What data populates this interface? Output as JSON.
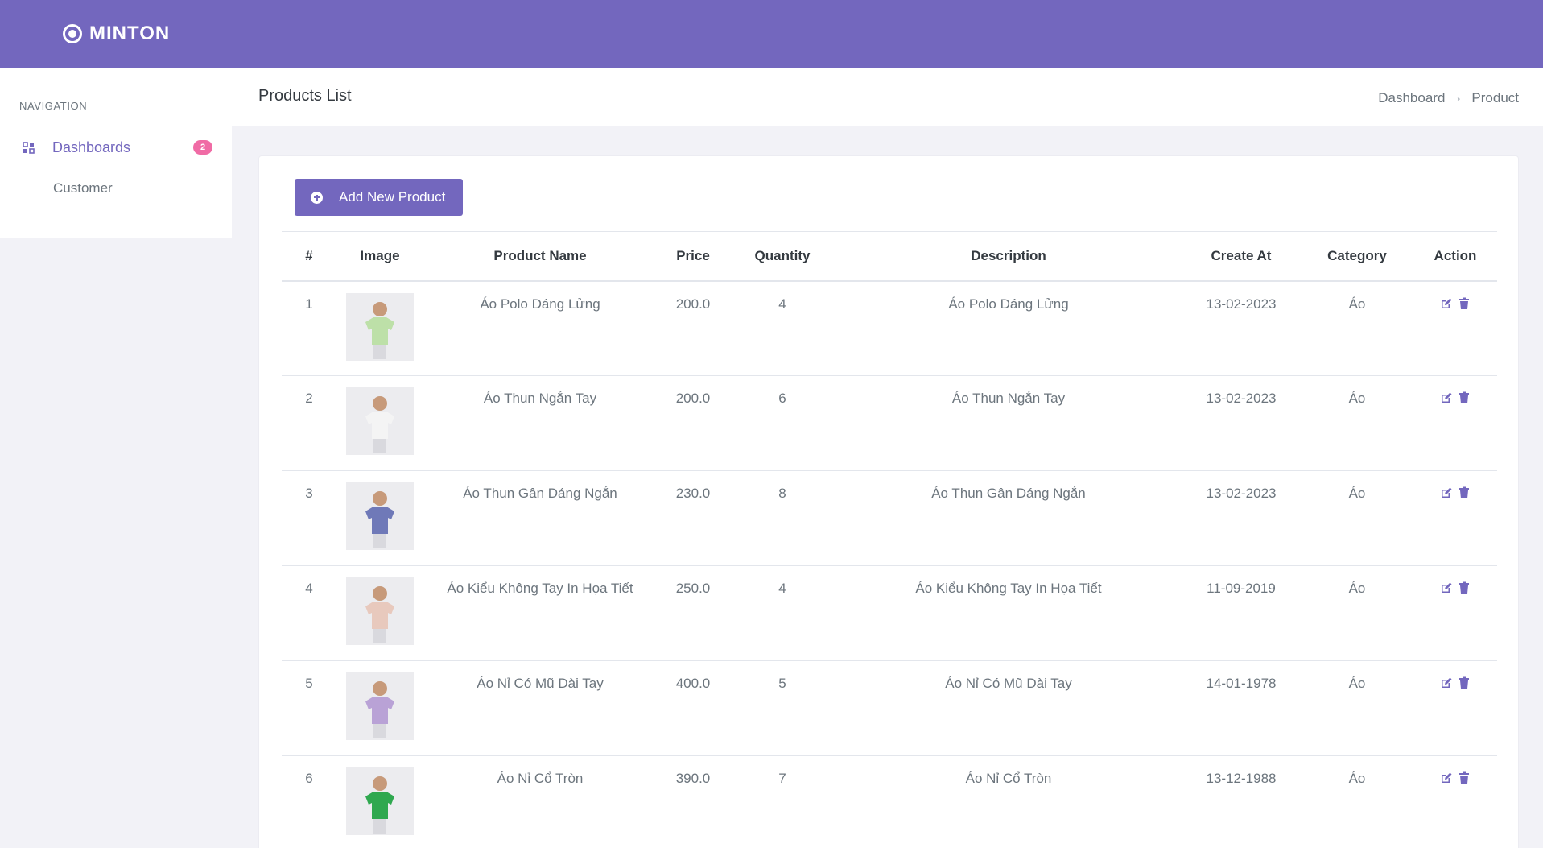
{
  "app": {
    "brand": "MINTON"
  },
  "sidebar": {
    "section_title": "NAVIGATION",
    "items": [
      {
        "label": "Dashboards",
        "badge": "2",
        "icon": "grid-icon"
      }
    ],
    "subitems": [
      {
        "label": "Customer"
      }
    ]
  },
  "header": {
    "title": "Products List",
    "breadcrumb": [
      "Dashboard",
      "Product"
    ]
  },
  "toolbar": {
    "add_label": "Add New Product"
  },
  "table": {
    "columns": [
      "#",
      "Image",
      "Product Name",
      "Price",
      "Quantity",
      "Description",
      "Create At",
      "Category",
      "Action"
    ],
    "rows": [
      {
        "id": "1",
        "name": "Áo Polo Dáng Lửng",
        "price": "200.0",
        "quantity": "4",
        "description": "Áo Polo Dáng Lửng",
        "created": "13-02-2023",
        "category": "Áo",
        "color": "#bde0a8"
      },
      {
        "id": "2",
        "name": "Áo Thun Ngắn Tay",
        "price": "200.0",
        "quantity": "6",
        "description": "Áo Thun Ngắn Tay",
        "created": "13-02-2023",
        "category": "Áo",
        "color": "#f4f4f4"
      },
      {
        "id": "3",
        "name": "Áo Thun Gân Dáng Ngắn",
        "price": "230.0",
        "quantity": "8",
        "description": "Áo Thun Gân Dáng Ngắn",
        "created": "13-02-2023",
        "category": "Áo",
        "color": "#6f79b8"
      },
      {
        "id": "4",
        "name": "Áo Kiểu Không Tay In Họa Tiết",
        "price": "250.0",
        "quantity": "4",
        "description": "Áo Kiểu Không Tay In Họa Tiết",
        "created": "11-09-2019",
        "category": "Áo",
        "color": "#e8c9bd"
      },
      {
        "id": "5",
        "name": "Áo Nỉ Có Mũ Dài Tay",
        "price": "400.0",
        "quantity": "5",
        "description": "Áo Nỉ Có Mũ Dài Tay",
        "created": "14-01-1978",
        "category": "Áo",
        "color": "#b9a2d6"
      },
      {
        "id": "6",
        "name": "Áo Nỉ Cổ Tròn",
        "price": "390.0",
        "quantity": "7",
        "description": "Áo Nỉ Cổ Tròn",
        "created": "13-12-1988",
        "category": "Áo",
        "color": "#2fa84f"
      }
    ]
  },
  "colors": {
    "primary": "#7367be",
    "badge": "#f06ba5",
    "background": "#f2f2f7"
  }
}
